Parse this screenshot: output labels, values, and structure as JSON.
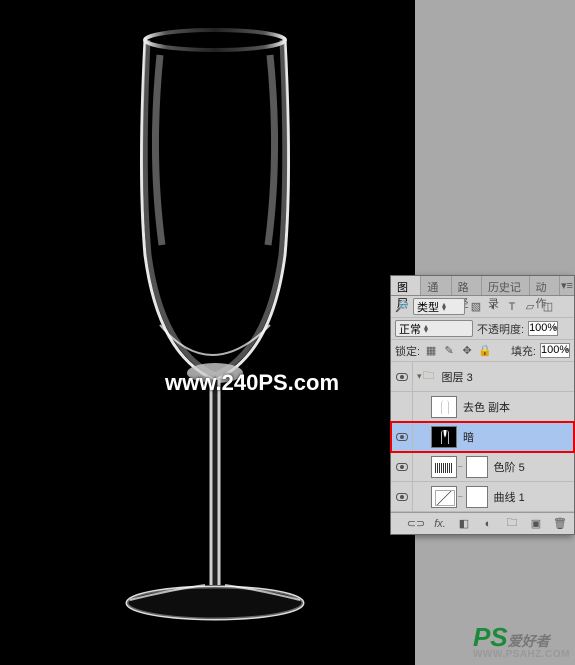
{
  "canvas": {
    "watermark": "www.240PS.com"
  },
  "corner": {
    "ps": "PS",
    "cn": "爱好者",
    "url": "WWW.PSAHZ.COM"
  },
  "panel": {
    "tabs": [
      "图层",
      "通道",
      "路径",
      "历史记录",
      "动作"
    ],
    "active_tab_index": 0,
    "type_label": "类型",
    "blend_mode": "正常",
    "opacity_label": "不透明度:",
    "opacity_value": "100%",
    "lock_label": "锁定:",
    "fill_label": "填充:",
    "fill_value": "100%"
  },
  "layers": {
    "group_name": "图层 3",
    "items": [
      {
        "visible": false,
        "name": "去色 副本",
        "thumb": "gray",
        "selected": false,
        "highlight": false,
        "mask": false
      },
      {
        "visible": true,
        "name": "暗",
        "thumb": "black",
        "selected": true,
        "highlight": true,
        "mask": false
      },
      {
        "visible": true,
        "name": "色阶 5",
        "thumb": "adj-levels",
        "selected": false,
        "highlight": false,
        "mask": true
      },
      {
        "visible": true,
        "name": "曲线 1",
        "thumb": "adj-curves",
        "selected": false,
        "highlight": false,
        "mask": true
      }
    ]
  },
  "icons": {
    "menu": "≡",
    "link": "⊂⊃",
    "fx": "fx.",
    "mask": "◧",
    "adjust": "◐",
    "folder": "🗀",
    "new": "▣",
    "trash": "🗑"
  }
}
